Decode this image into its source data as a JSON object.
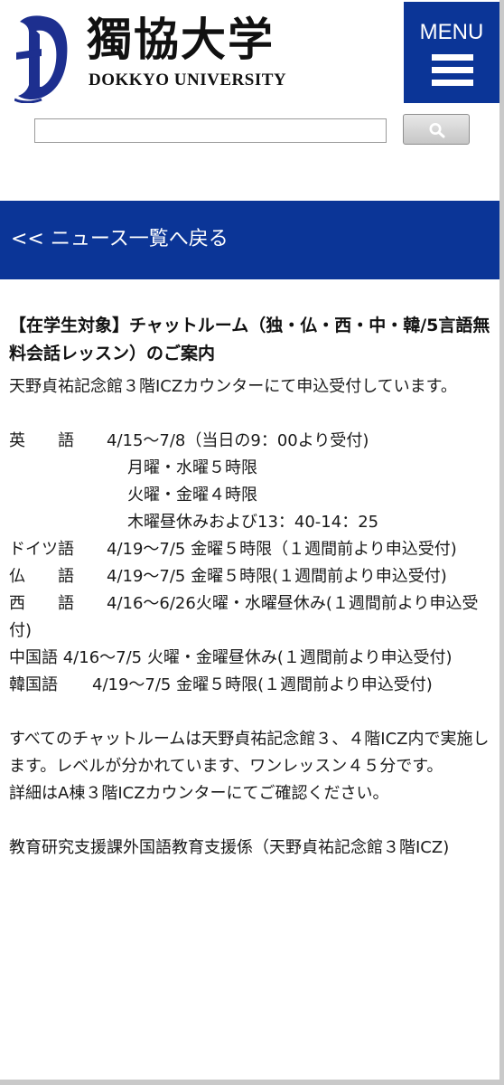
{
  "header": {
    "logo_jp": "獨協大学",
    "logo_en": "DOKKYO UNIVERSITY",
    "menu_label": "MENU",
    "search": {
      "value": "",
      "placeholder": ""
    }
  },
  "nav": {
    "back_label": "<< ニュース一覧へ戻る"
  },
  "article": {
    "title": "【在学生対象】チャットルーム（独・仏・西・中・韓/5言語無料会話レッスン）のご案内",
    "intro": "天野貞祐記念館３階ICZカウンターにて申込受付しています。",
    "schedule": {
      "english": {
        "lang": "英　　語",
        "line1": "4/15〜7/8（当日の9：00より受付)",
        "line2": "月曜・水曜５時限",
        "line3": "火曜・金曜４時限",
        "line4": "木曜昼休みおよび13：40-14：25"
      },
      "german": {
        "lang": "ドイツ語",
        "text": "4/19〜7/5 金曜５時限（１週間前より申込受付)"
      },
      "french": {
        "lang": "仏　　語",
        "text": "4/19〜7/5 金曜５時限(１週間前より申込受付)"
      },
      "spanish": {
        "lang": "西　　語",
        "text": "4/16〜6/26火曜・水曜昼休み(１週間前より申込受付)"
      },
      "chinese": {
        "lang": "中国語",
        "text": "4/16〜7/5 火曜・金曜昼休み(１週間前より申込受付)"
      },
      "korean": {
        "lang": "韓国語",
        "text": "4/19〜7/5 金曜５時限(１週間前より申込受付)"
      }
    },
    "note1": "すべてのチャットルームは天野貞祐記念館３、４階ICZ内で実施します。レベルが分かれています、ワンレッスン４５分です。",
    "note2": "詳細はA棟３階ICZカウンターにてご確認ください。",
    "contact": "教育研究支援課外国語教育支援係（天野貞祐記念館３階ICZ)"
  },
  "colors": {
    "brand_blue": "#0b3597",
    "logo_blue": "#1d2f8f",
    "text": "#111111"
  },
  "icons": {
    "logo": "university-crest-icon",
    "menu": "hamburger-icon",
    "search": "search-icon"
  }
}
